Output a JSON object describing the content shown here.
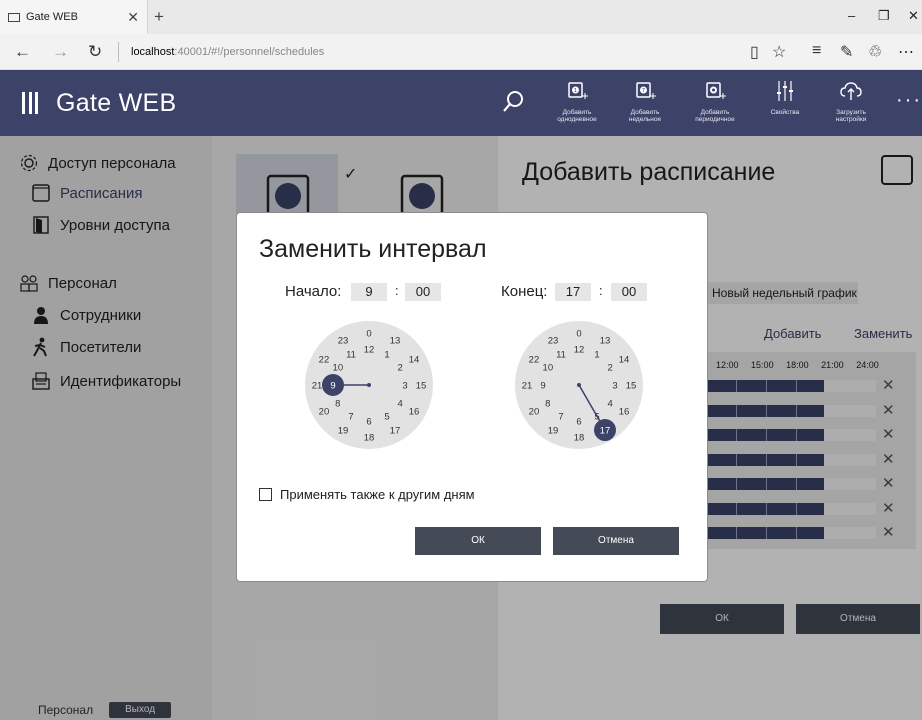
{
  "browser": {
    "tab_title": "Gate WEB",
    "url_host": "localhost",
    "url_path": ":40001/#!/personnel/schedules"
  },
  "app": {
    "title": "Gate WEB",
    "toolbar": [
      {
        "label_line1": "Добавить",
        "label_line2": "однодневное",
        "icon": "add-daily-schedule-icon",
        "number": "1"
      },
      {
        "label_line1": "Добавить",
        "label_line2": "недельное",
        "icon": "add-weekly-schedule-icon",
        "number": "7"
      },
      {
        "label_line1": "Добавить",
        "label_line2": "периодичное",
        "icon": "add-periodic-schedule-icon",
        "number": ""
      },
      {
        "label_line1": "Свойства",
        "label_line2": "",
        "icon": "properties-icon",
        "number": ""
      },
      {
        "label_line1": "Загрузить",
        "label_line2": "настройки",
        "icon": "upload-settings-icon",
        "number": ""
      }
    ]
  },
  "sidebar": {
    "items": [
      {
        "label": "Доступ персонала",
        "icon": "gear-icon"
      },
      {
        "label": "Расписания",
        "icon": "calendar-icon"
      },
      {
        "label": "Уровни доступа",
        "icon": "door-icon"
      },
      {
        "label": "Персонал",
        "icon": "people-icon"
      },
      {
        "label": "Сотрудники",
        "icon": "employee-icon"
      },
      {
        "label": "Посетители",
        "icon": "visitor-icon"
      },
      {
        "label": "Идентификаторы",
        "icon": "card-reader-icon"
      }
    ],
    "footer_label": "Персонал",
    "logout_label": "Выход"
  },
  "right_panel": {
    "title": "Добавить расписание",
    "schedule_name": "Новый недельный график",
    "add_link": "Добавить",
    "replace_link": "Заменить",
    "ticks": [
      "12:00",
      "15:00",
      "18:00",
      "21:00",
      "24:00"
    ],
    "rows": 7,
    "ok_label": "ОК",
    "cancel_label": "Отмена"
  },
  "modal": {
    "title": "Заменить интервал",
    "start_label": "Начало:",
    "start_hour": "9",
    "start_min": "00",
    "end_label": "Конец:",
    "end_hour": "17",
    "end_min": "00",
    "checkbox_label": "Применять также к другим дням",
    "checkbox_checked": false,
    "ok_label": "ОК",
    "cancel_label": "Отмена"
  },
  "colors": {
    "accent": "#3c4268",
    "button": "#444a56",
    "clock_face": "#e2e2e2"
  }
}
